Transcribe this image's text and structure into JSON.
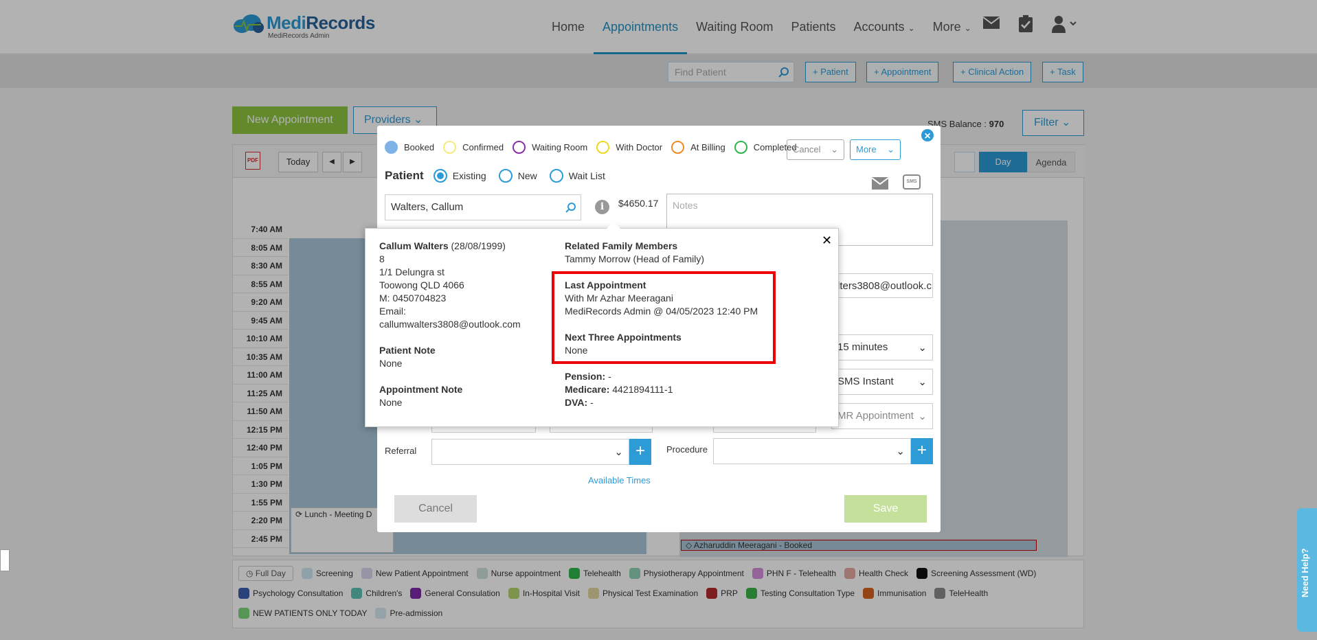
{
  "app": {
    "brand_part1": "Medi",
    "brand_part2": "Records",
    "brand_sub": "MediRecords Admin"
  },
  "nav": {
    "items": [
      {
        "label": "Home"
      },
      {
        "label": "Appointments"
      },
      {
        "label": "Waiting Room"
      },
      {
        "label": "Patients"
      },
      {
        "label": "Accounts"
      },
      {
        "label": "More"
      }
    ]
  },
  "toolbar": {
    "find_placeholder": "Find Patient",
    "buttons": [
      "+ Patient",
      "+ Appointment",
      "+ Clinical Action",
      "+ Task"
    ]
  },
  "page": {
    "new_appointment": "New Appointment",
    "providers": "Providers",
    "sms_label": "SMS Balance :",
    "sms_value": "970",
    "filter": "Filter"
  },
  "calendar": {
    "today": "Today",
    "day": "Day",
    "agenda": "Agenda",
    "times": [
      "7:40 AM",
      "8:05 AM",
      "8:30 AM",
      "8:55 AM",
      "9:20 AM",
      "9:45 AM",
      "10:10 AM",
      "10:35 AM",
      "11:00 AM",
      "11:25 AM",
      "11:50 AM",
      "12:15 PM",
      "12:40 PM",
      "1:05 PM",
      "1:30 PM",
      "1:55 PM",
      "2:20 PM",
      "2:45 PM"
    ],
    "lunch": "Lunch - Meeting D",
    "booked": "Azharuddin Meeragani - Booked"
  },
  "legend": {
    "full_day": "Full Day",
    "items": [
      {
        "label": "Screening",
        "color": "#cfe7f2"
      },
      {
        "label": "New Patient Appointment",
        "color": "#d9d4ee"
      },
      {
        "label": "Nurse appointment",
        "color": "#cfe0dc"
      },
      {
        "label": "Telehealth",
        "color": "#2db84a"
      },
      {
        "label": "Physiotherapy Appointment",
        "color": "#8fd3b6"
      },
      {
        "label": "PHN F - Telehealth",
        "color": "#d58fd8"
      },
      {
        "label": "Health Check",
        "color": "#e6a9a3"
      },
      {
        "label": "Screening Assessment (WD)",
        "color": "#111111"
      },
      {
        "label": "Psychology Consultation",
        "color": "#3b5fb0"
      },
      {
        "label": "Children's",
        "color": "#5ec2b4"
      },
      {
        "label": "General Consulation",
        "color": "#7f2aa6"
      },
      {
        "label": "In-Hospital Visit",
        "color": "#b3d56b"
      },
      {
        "label": "Physical Test Examination",
        "color": "#e5d6a3"
      },
      {
        "label": "PRP",
        "color": "#b42a2a"
      },
      {
        "label": "Testing Consultation Type",
        "color": "#39b54a"
      },
      {
        "label": "Immunisation",
        "color": "#d9621e"
      },
      {
        "label": "TeleHealth",
        "color": "#8a8a8a"
      },
      {
        "label": "NEW PATIENTS ONLY TODAY",
        "color": "#7ed67a"
      },
      {
        "label": "Pre-admission",
        "color": "#d6e8f2"
      }
    ]
  },
  "modal": {
    "statuses": [
      {
        "label": "Booked",
        "color": "#7fb3e8",
        "filled": true
      },
      {
        "label": "Confirmed",
        "color": "#f2ec7a",
        "filled": false
      },
      {
        "label": "Waiting Room",
        "color": "#8b2ea6",
        "filled": false
      },
      {
        "label": "With Doctor",
        "color": "#f0d820",
        "filled": false
      },
      {
        "label": "At Billing",
        "color": "#f08a24",
        "filled": false
      },
      {
        "label": "Completed",
        "color": "#2fb34a",
        "filled": false
      }
    ],
    "cancel_dd": "Cancel",
    "more_dd": "More",
    "patient_label": "Patient",
    "patient_options": [
      "Existing",
      "New",
      "Wait List"
    ],
    "patient_value": "Walters, Callum",
    "balance": "$4650.17",
    "notes_placeholder": "Notes",
    "email_value": "lters3808@outlook.c",
    "duration": "15 minutes",
    "reminder": "SMS Instant",
    "appt_type": "MR Appointment",
    "referral_label": "Referral",
    "procedure_label": "Procedure",
    "available_times": "Available Times",
    "cancel": "Cancel",
    "save": "Save"
  },
  "popup": {
    "name": "Callum Walters",
    "dob": "(28/08/1999)",
    "addr_lines": [
      "8",
      "1/1 Delungra st",
      "Toowong QLD 4066",
      "M: 0450704823",
      "Email:",
      "callumwalters3808@outlook.com"
    ],
    "patient_note_title": "Patient Note",
    "patient_note_value": "None",
    "appt_note_title": "Appointment Note",
    "appt_note_value": "None",
    "family_title": "Related Family Members",
    "family_value": "Tammy Morrow (Head of Family)",
    "last_title": "Last Appointment",
    "last_line1": "With Mr Azhar Meeragani",
    "last_line2": "MediRecords Admin @ 04/05/2023 12:40 PM",
    "next_title": "Next Three Appointments",
    "next_value": "None",
    "pension_label": "Pension:",
    "pension_value": "-",
    "medicare_label": "Medicare:",
    "medicare_value": "4421894111-1",
    "dva_label": "DVA:",
    "dva_value": "-"
  },
  "help": {
    "label": "Need Help?"
  }
}
